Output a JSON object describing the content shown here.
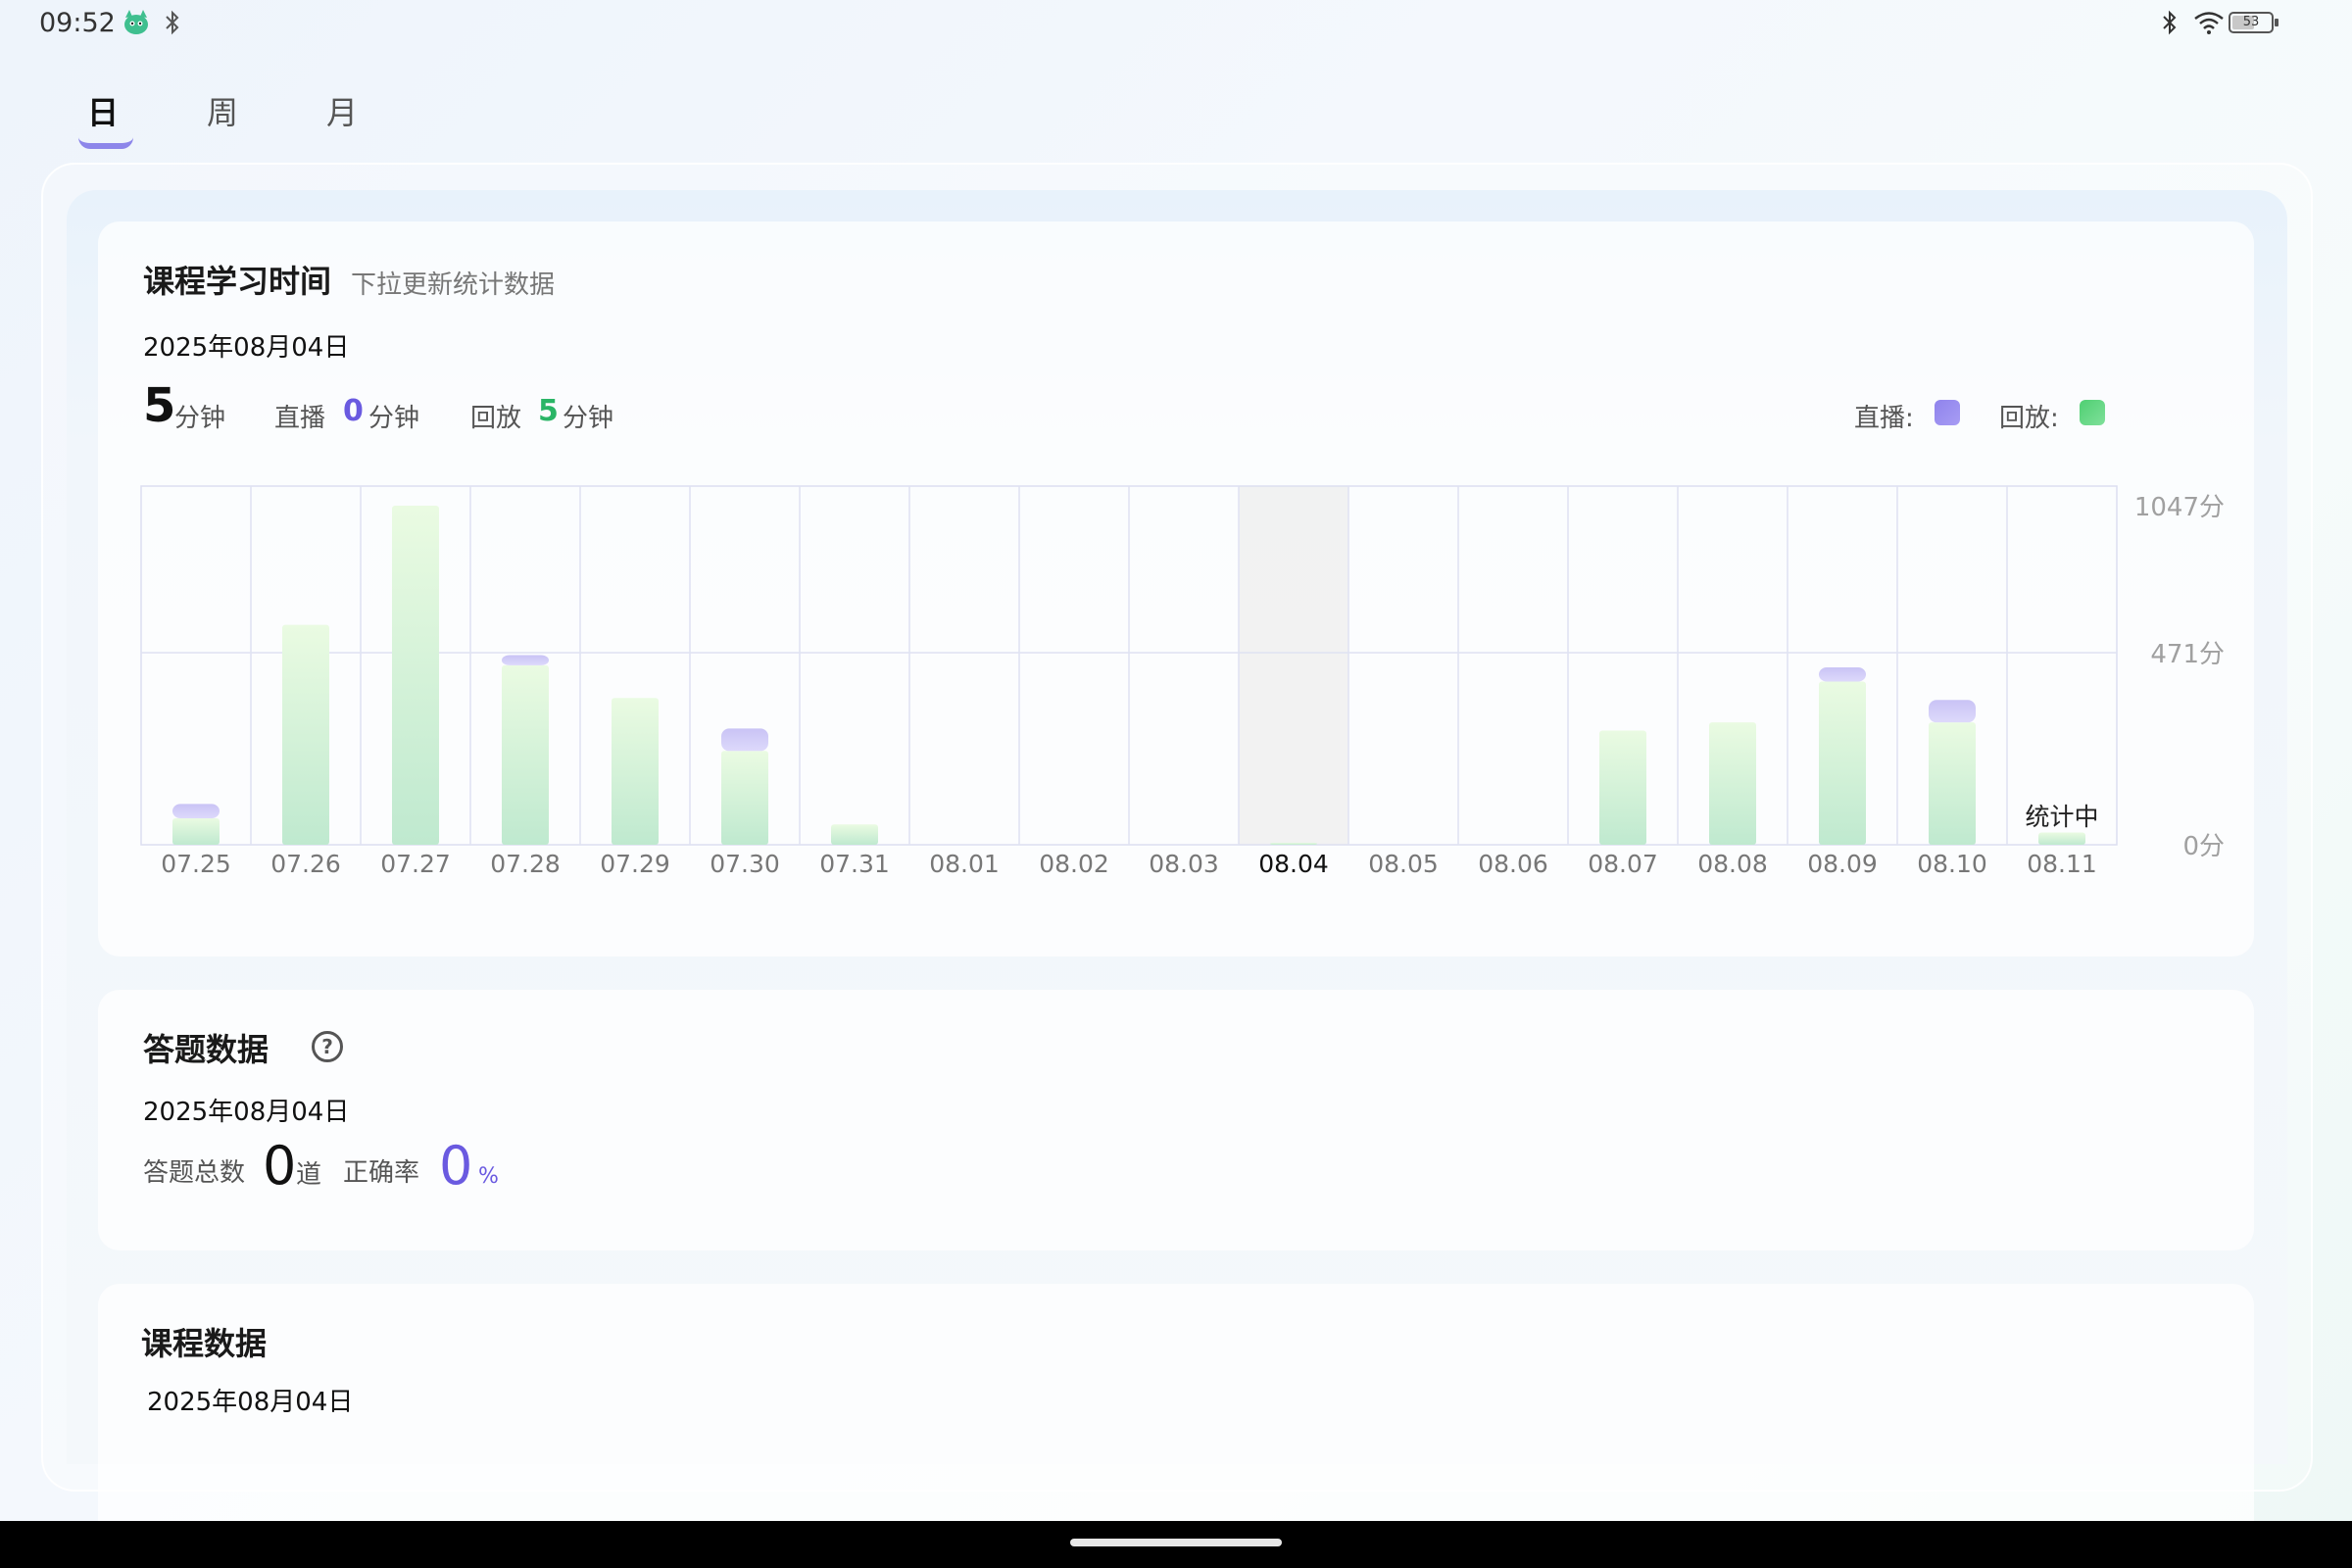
{
  "status_bar": {
    "time": "09:52",
    "app_icon": "mascot-icon",
    "battery": "53"
  },
  "tabs": [
    {
      "label": "日",
      "active": true
    },
    {
      "label": "周",
      "active": false
    },
    {
      "label": "月",
      "active": false
    }
  ],
  "study_card": {
    "title": "课程学习时间",
    "subtitle": "下拉更新统计数据",
    "date": "2025年08月04日",
    "total_value": "5",
    "total_unit": "分钟",
    "live_label": "直播",
    "live_value": "0",
    "live_unit": "分钟",
    "replay_label": "回放",
    "replay_value": "5",
    "replay_unit": "分钟",
    "legend_live": "直播:",
    "legend_replay": "回放:",
    "colors": {
      "live": "#8f83ec",
      "replay": "#5fd27e"
    }
  },
  "chart_data": {
    "type": "bar",
    "stacked": true,
    "categories": [
      "07.25",
      "07.26",
      "07.27",
      "07.28",
      "07.29",
      "07.30",
      "07.31",
      "08.01",
      "08.02",
      "08.03",
      "08.04",
      "08.05",
      "08.06",
      "08.07",
      "08.08",
      "08.09",
      "08.10",
      "08.11"
    ],
    "series": [
      {
        "name": "回放",
        "values": [
          65,
          580,
          1047,
          440,
          360,
          230,
          50,
          0,
          0,
          0,
          5,
          0,
          0,
          280,
          300,
          400,
          300,
          30
        ]
      },
      {
        "name": "直播",
        "values": [
          35,
          0,
          0,
          25,
          0,
          55,
          0,
          0,
          0,
          0,
          0,
          0,
          0,
          0,
          0,
          35,
          55,
          0
        ]
      }
    ],
    "y_tick_labels": [
      "1047分",
      "471分",
      "0分"
    ],
    "selected_category": "08.04",
    "in_progress_label": "统计中",
    "in_progress_category": "08.11",
    "grid": true
  },
  "answer_card": {
    "title": "答题数据",
    "date": "2025年08月04日",
    "total_label": "答题总数",
    "total_value": "0",
    "total_unit": "道",
    "rate_label": "正确率",
    "rate_value": "0",
    "rate_unit": "%"
  },
  "course_card": {
    "title": "课程数据",
    "date": "2025年08月04日"
  }
}
